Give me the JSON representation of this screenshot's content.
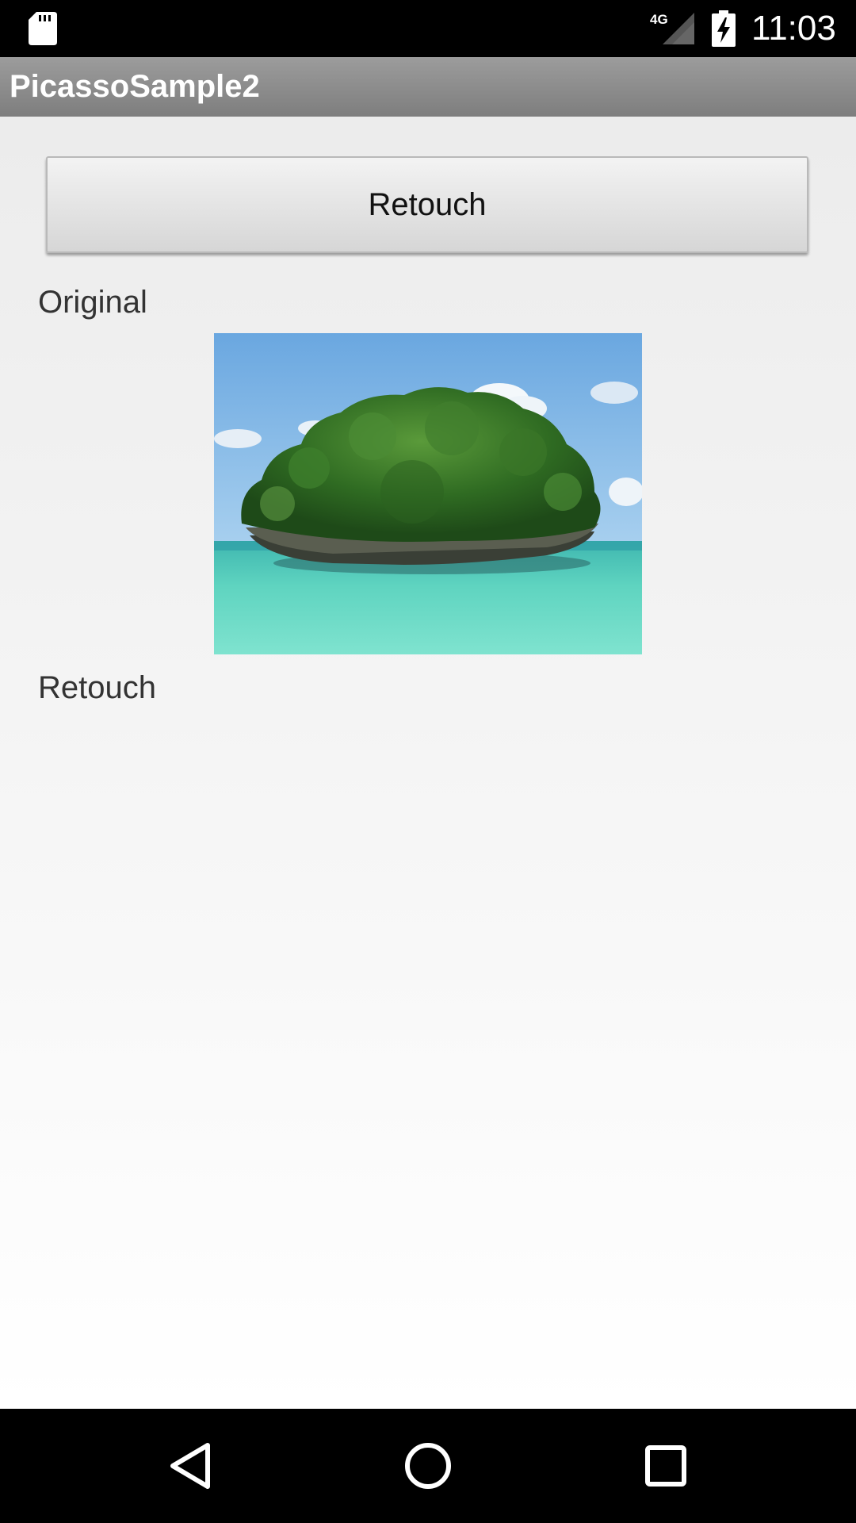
{
  "status_bar": {
    "time": "11:03",
    "network": "4G",
    "icons": [
      "sd-card-icon",
      "signal-4g-icon",
      "battery-charging-icon"
    ]
  },
  "action_bar": {
    "title": "PicassoSample2"
  },
  "main": {
    "retouch_button_label": "Retouch",
    "original_label": "Original",
    "retouch_label": "Retouch"
  },
  "nav_bar": {
    "icons": [
      "back-icon",
      "home-icon",
      "recents-icon"
    ]
  },
  "colors": {
    "action_bar": "#8a8a8a",
    "status_bar": "#000000",
    "nav_bar": "#000000",
    "content_background": "#ececec"
  }
}
